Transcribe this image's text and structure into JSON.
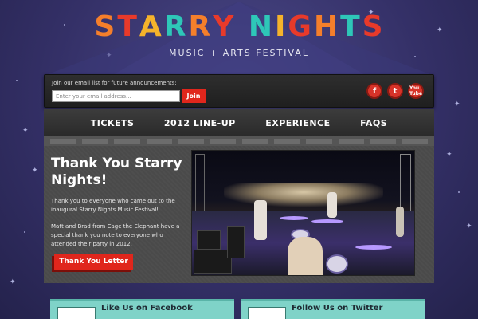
{
  "header": {
    "logo_text": "STARRY NIGHTS",
    "logo_letters": [
      "S",
      "T",
      "A",
      "R",
      "R",
      "Y",
      " ",
      "N",
      "I",
      "G",
      "H",
      "T",
      "S"
    ],
    "logo_colors": [
      "#f57f2b",
      "#e83a2a",
      "#f5b32b",
      "#2ec7b8",
      "#f57f2b",
      "#e83a2a",
      "#ffffff",
      "#2ec7b8",
      "#f5b32b",
      "#e83a2a",
      "#f57f2b",
      "#2ec7b8",
      "#e83a2a"
    ],
    "tagline": "MUSIC + ARTS FESTIVAL"
  },
  "email_signup": {
    "label": "Join our email list for future announcements:",
    "placeholder": "Enter your email address...",
    "join_label": "Join"
  },
  "social": {
    "facebook": "f",
    "twitter": "t",
    "youtube": "You Tube"
  },
  "nav": {
    "items": [
      "TICKETS",
      "2012 LINE-UP",
      "EXPERIENCE",
      "FAQS"
    ]
  },
  "main": {
    "heading": "Thank You Starry Nights!",
    "paragraph1": "Thank you to everyone who came out to the inaugural Starry Nights Music Festival!",
    "paragraph2": "Matt and Brad from Cage the Elephant have a special thank you note to everyone who attended their party in 2012.",
    "button_label": "Thank You Letter"
  },
  "panels": {
    "facebook_title": "Like Us on Facebook",
    "twitter_title": "Follow Us on Twitter"
  },
  "colors": {
    "accent_red": "#e0261c",
    "panel_teal": "#7fd3c8",
    "sky": "#343067"
  }
}
